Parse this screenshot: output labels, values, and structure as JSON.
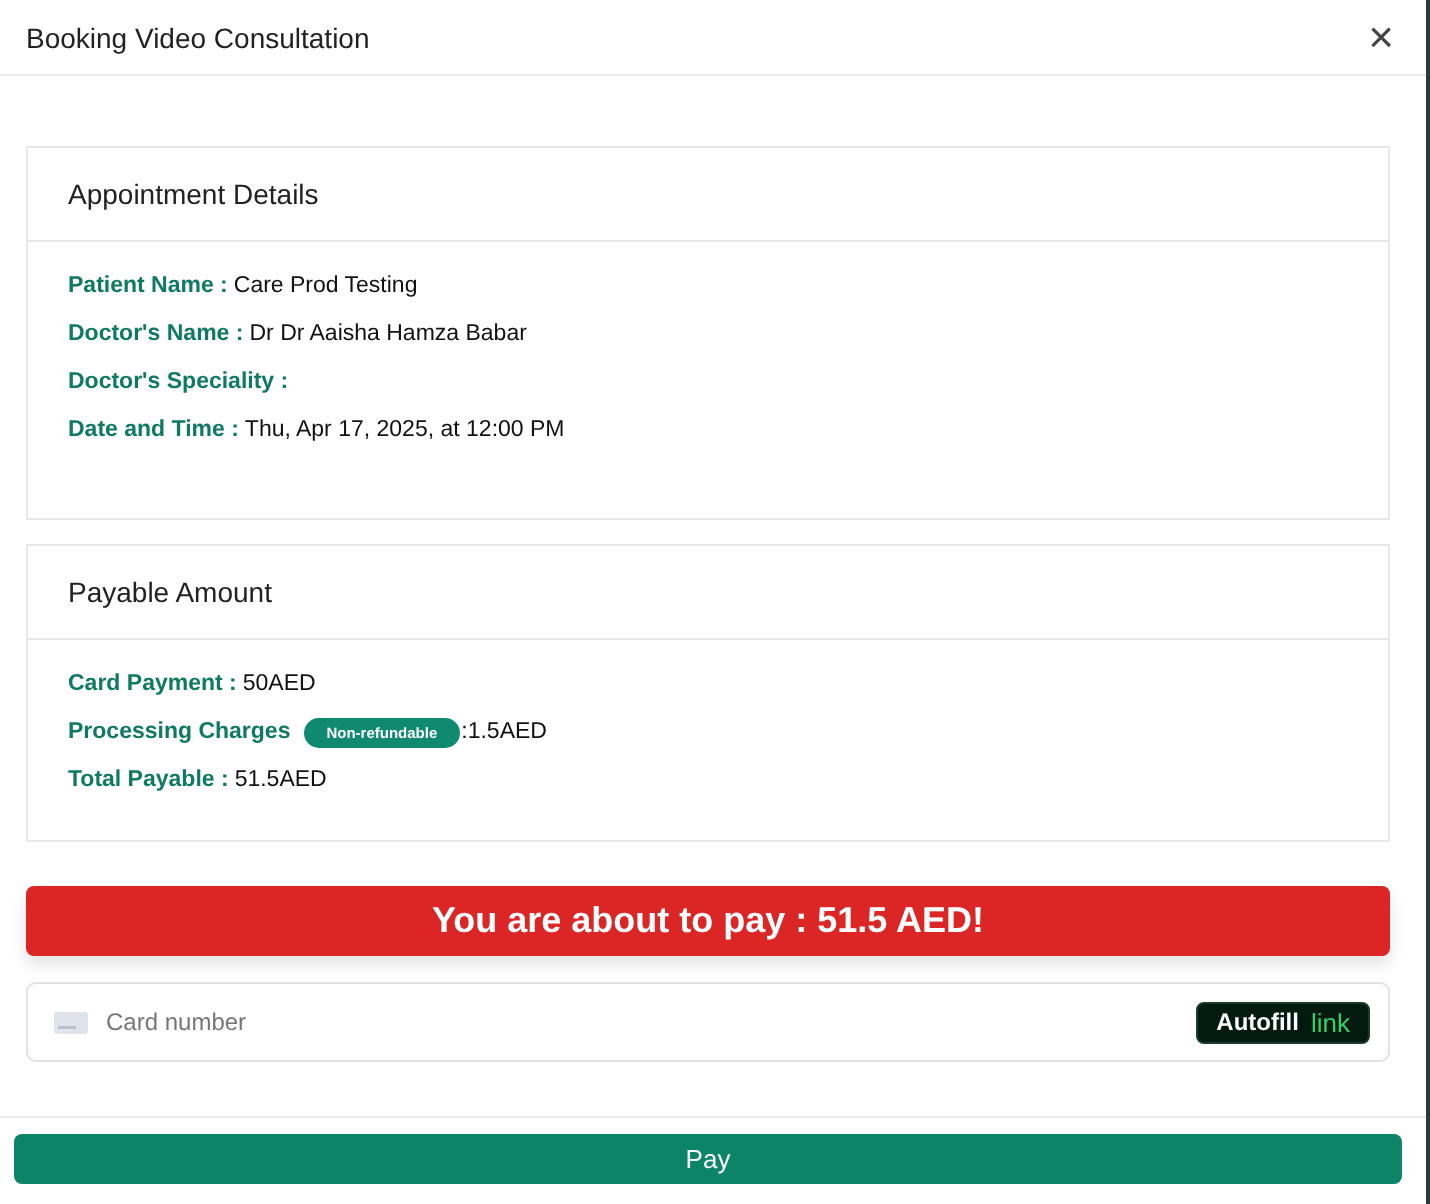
{
  "window": {
    "title": "Booking Video Consultation",
    "close": "×"
  },
  "cards": [
    {
      "title": "Appointment Details",
      "rows": [
        {
          "label": "Patient Name :",
          "value": "Care Prod Testing"
        },
        {
          "label": "Doctor's Name :",
          "value": "Dr Dr Aaisha Hamza Babar"
        },
        {
          "label": "Doctor's Speciality :"
        },
        {
          "label": "Date and Time :",
          "value": "Thu, Apr 17, 2025, at 12:00 PM"
        }
      ]
    },
    {
      "title": "Payable Amount",
      "rows": [
        {
          "label": "Card Payment :",
          "value": "50AED"
        },
        {
          "label": "Processing Charges",
          "badge": "Non-refundable",
          "value": ":1.5AED"
        },
        {
          "label": "Total Payable :",
          "value": "51.5AED"
        }
      ]
    }
  ],
  "banner": "You are about to pay : 51.5 AED!",
  "card_field": {
    "placeholder": "Card number",
    "autofill": {
      "label": "Autofill",
      "brand": "link"
    }
  },
  "buttons": [
    {
      "label": "Pay"
    }
  ]
}
